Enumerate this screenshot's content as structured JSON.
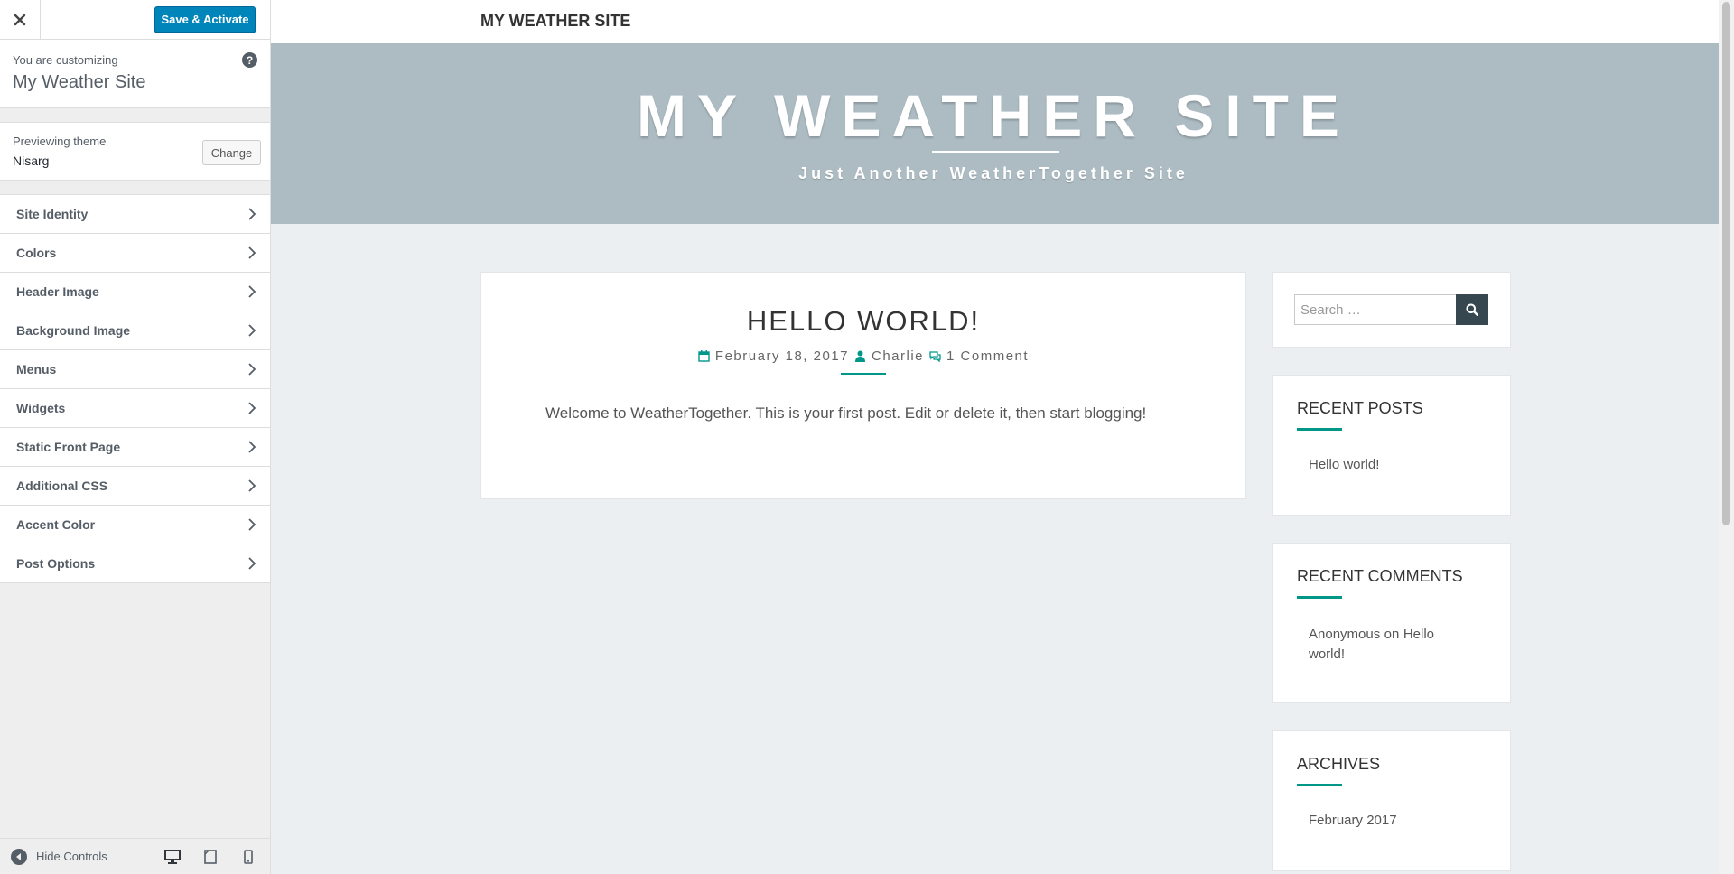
{
  "customizer": {
    "close_icon": "close-icon",
    "save_label": "Save & Activate",
    "info": {
      "pre": "You are customizing",
      "title": "My Weather Site",
      "help_icon": "question-icon",
      "help_glyph": "?"
    },
    "theme": {
      "pre": "Previewing theme",
      "name": "Nisarg",
      "change_label": "Change"
    },
    "sections": [
      {
        "label": "Site Identity"
      },
      {
        "label": "Colors"
      },
      {
        "label": "Header Image"
      },
      {
        "label": "Background Image"
      },
      {
        "label": "Menus"
      },
      {
        "label": "Widgets"
      },
      {
        "label": "Static Front Page"
      },
      {
        "label": "Additional CSS"
      },
      {
        "label": "Accent Color"
      },
      {
        "label": "Post Options"
      }
    ],
    "footer": {
      "hide_label": "Hide Controls",
      "devices": [
        "desktop-icon",
        "tablet-icon",
        "mobile-icon"
      ]
    },
    "colors": {
      "primary": "#0085ba",
      "text": "#555d66"
    }
  },
  "site": {
    "brand": "MY WEATHER SITE",
    "hero_title": "MY WEATHER SITE",
    "tagline": "Just Another WeatherTogether Site",
    "accent": "#009688",
    "hero_bg": "#adbcc3"
  },
  "post": {
    "title": "HELLO WORLD!",
    "date": "February 18, 2017",
    "author": "Charlie",
    "comments": "1 Comment",
    "excerpt": "Welcome to WeatherTogether. This is your first post. Edit or delete it, then start blogging!"
  },
  "sidebar_widgets": {
    "search_placeholder": "Search …",
    "recent_posts": {
      "title": "RECENT POSTS",
      "items": [
        "Hello world!"
      ]
    },
    "recent_comments": {
      "title": "RECENT COMMENTS",
      "author": "Anonymous",
      "on": "on",
      "link_line1": "Hello",
      "link_line2": "world!"
    },
    "archives": {
      "title": "ARCHIVES",
      "items": [
        "February 2017"
      ]
    }
  }
}
